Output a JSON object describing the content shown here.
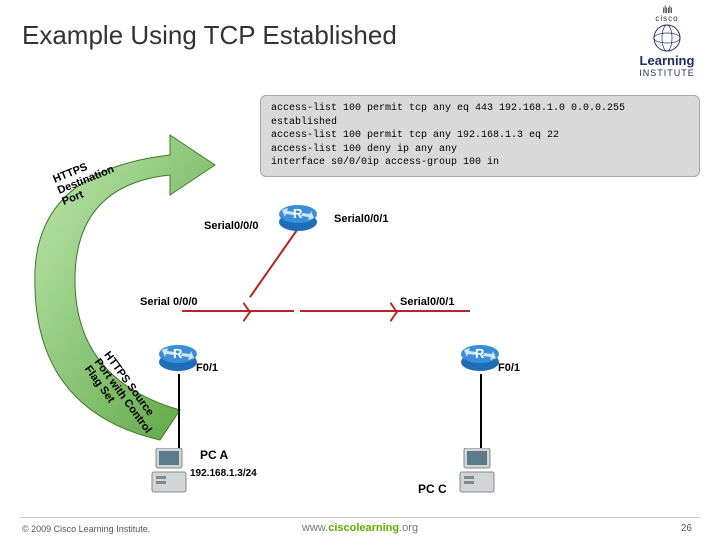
{
  "title": "Example Using TCP Established",
  "logo": {
    "brand": "cisco",
    "main": "Learning",
    "sub": "INSTITUTE"
  },
  "acl": "access-list 100 permit tcp any eq 443 192.168.1.0 0.0.0.255\nestablished\naccess-list 100 permit tcp any 192.168.1.3 eq 22\naccess-list 100 deny ip any any\ninterface s0/0/0ip access-group 100 in",
  "labels": {
    "https_dest": "HTTPS\nDestination\nPort",
    "https_src": "HTTPS Source\nPort with Control\nFlag Set",
    "serial_tl": "Serial0/0/0",
    "serial_tr": "Serial0/0/1",
    "serial_ml": "Serial 0/0/0",
    "serial_mr": "Serial0/0/1",
    "f01_l": "F0/1",
    "f01_r": "F0/1",
    "router_r": "R",
    "pca": "PC A",
    "pca_ip": "192.168.1.3/24",
    "pcc": "PC C"
  },
  "footer": {
    "copyright": "© 2009 Cisco Learning Institute.",
    "url_pre": "www.",
    "url_mid": "ciscolearning",
    "url_suf": ".org",
    "page": "26"
  }
}
